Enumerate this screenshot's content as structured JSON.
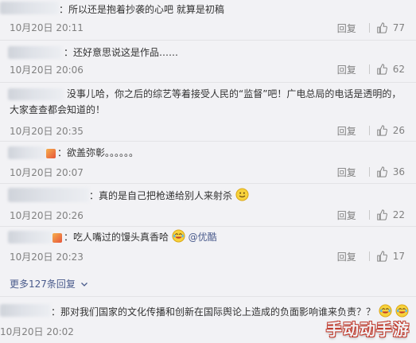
{
  "comments": [
    {
      "text": "：所以还是抱着抄袭的心吧 就算是初稿",
      "time": "10月20日 20:11",
      "reply": "回复",
      "likes": "77"
    },
    {
      "text": "：还好意思说这是作品……",
      "time": "10月20日 20:06",
      "reply": "回复",
      "likes": "62"
    },
    {
      "text": "没事儿哈，你之后的综艺等着接受人民的“监督”吧！广电总局的电话是透明的，大家查查都会知道的！",
      "time": "10月20日 20:35",
      "reply": "回复",
      "likes": "26"
    },
    {
      "text": "：欲盖弥彰。。。。。。",
      "time": "10月20日 20:07",
      "reply": "回复",
      "likes": "36"
    },
    {
      "text": "：真的是自己把枪递给别人来射杀",
      "time": "10月20日 20:26",
      "reply": "回复",
      "likes": "22"
    },
    {
      "text": "：吃人嘴过的馒头真香哈",
      "mention": "@优酷",
      "time": "10月20日 20:23",
      "reply": "回复",
      "likes": "17"
    }
  ],
  "more_replies": "更多127条回复",
  "last_comment": {
    "text": "：那对我们国家的文化传播和创新在国际舆论上造成的负面影响谁来负责？？",
    "time": "10月20日 20:02"
  },
  "watermark": "手动动手游",
  "colors": {
    "background": "#f2f2f5",
    "link": "#4a5b8c",
    "muted": "#808080"
  },
  "icons": {
    "like": "thumb-up-icon",
    "expand": "chevron-down-icon"
  }
}
